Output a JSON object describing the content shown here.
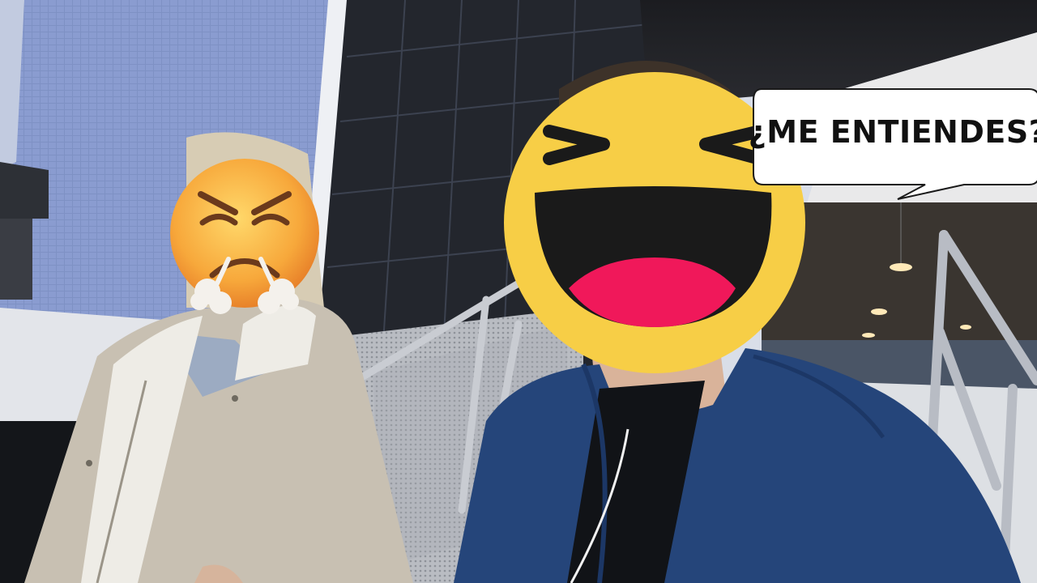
{
  "caption": {
    "text": "¿ME ENTIENDES?"
  },
  "emojis": {
    "left": "angry-huffing-face-emoji",
    "right": "laughing-squinting-face-emoji"
  },
  "colors": {
    "sky": "#c9d3e3",
    "wall_blue": "#7f93c9",
    "glass_dark": "#1e2128",
    "jacket_beige": "#c8c0b2",
    "jacket_blue": "#25457a",
    "emoji_yellow": "#f7ce46",
    "bubble_fill": "#ffffff"
  }
}
